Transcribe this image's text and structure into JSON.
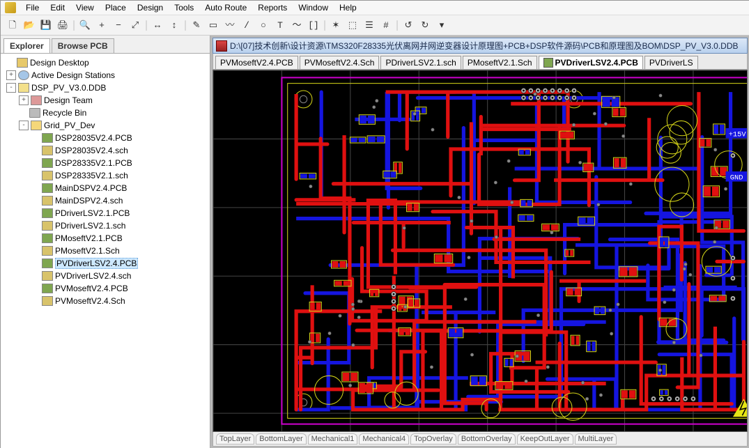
{
  "menu": {
    "items": [
      "File",
      "Edit",
      "View",
      "Place",
      "Design",
      "Tools",
      "Auto Route",
      "Reports",
      "Window",
      "Help"
    ]
  },
  "toolbar": {
    "buttons": [
      "🗋",
      "📂",
      "💾",
      "🖨",
      "|",
      "🔍",
      "+",
      "−",
      "⤢",
      "|",
      "↔",
      "↕",
      "|",
      "✎",
      "▭",
      "〰",
      "/",
      "○",
      "T",
      "〜",
      "[]",
      "|",
      "✶",
      "⬚",
      "☰",
      "#",
      "|",
      "↺",
      "↻",
      "▾"
    ]
  },
  "left_tabs": {
    "tabs": [
      {
        "label": "Explorer",
        "active": true
      },
      {
        "label": "Browse PCB",
        "active": false
      }
    ]
  },
  "tree": [
    {
      "depth": 0,
      "tw": "",
      "icon": "desk",
      "label": "Design Desktop"
    },
    {
      "depth": 0,
      "tw": "+",
      "icon": "net",
      "label": "Active Design Stations"
    },
    {
      "depth": 0,
      "tw": "-",
      "icon": "ddb",
      "label": "DSP_PV_V3.0.DDB"
    },
    {
      "depth": 1,
      "tw": "+",
      "icon": "team",
      "label": "Design Team"
    },
    {
      "depth": 1,
      "tw": "",
      "icon": "bin",
      "label": "Recycle Bin"
    },
    {
      "depth": 1,
      "tw": "-",
      "icon": "fld",
      "label": "Grid_PV_Dev"
    },
    {
      "depth": 2,
      "tw": "",
      "icon": "pcb",
      "label": "DSP28035V2.4.PCB"
    },
    {
      "depth": 2,
      "tw": "",
      "icon": "sch",
      "label": "DSP28035V2.4.sch"
    },
    {
      "depth": 2,
      "tw": "",
      "icon": "pcb",
      "label": "DSP28335V2.1.PCB"
    },
    {
      "depth": 2,
      "tw": "",
      "icon": "sch",
      "label": "DSP28335V2.1.sch"
    },
    {
      "depth": 2,
      "tw": "",
      "icon": "pcb",
      "label": "MainDSPV2.4.PCB"
    },
    {
      "depth": 2,
      "tw": "",
      "icon": "sch",
      "label": "MainDSPV2.4.sch"
    },
    {
      "depth": 2,
      "tw": "",
      "icon": "pcb",
      "label": "PDriverLSV2.1.PCB"
    },
    {
      "depth": 2,
      "tw": "",
      "icon": "sch",
      "label": "PDriverLSV2.1.sch"
    },
    {
      "depth": 2,
      "tw": "",
      "icon": "pcb",
      "label": "PMoseftV2.1.PCB"
    },
    {
      "depth": 2,
      "tw": "",
      "icon": "sch",
      "label": "PMoseftV2.1.Sch"
    },
    {
      "depth": 2,
      "tw": "",
      "icon": "pcb",
      "label": "PVDriverLSV2.4.PCB",
      "selected": true
    },
    {
      "depth": 2,
      "tw": "",
      "icon": "sch",
      "label": "PVDriverLSV2.4.sch"
    },
    {
      "depth": 2,
      "tw": "",
      "icon": "pcb",
      "label": "PVMoseftV2.4.PCB"
    },
    {
      "depth": 2,
      "tw": "",
      "icon": "sch",
      "label": "PVMoseftV2.4.Sch"
    }
  ],
  "doc_title": "D:\\[07]技术创新\\设计资源\\TMS320F28335光伏离网并网逆变器设计原理图+PCB+DSP软件源码\\PCB和原理图及BOM\\DSP_PV_V3.0.DDB",
  "doc_tabs": [
    {
      "label": "PVMoseftV2.4.PCB",
      "active": false,
      "icon": false
    },
    {
      "label": "PVMoseftV2.4.Sch",
      "active": false,
      "icon": false
    },
    {
      "label": "PDriverLSV2.1.sch",
      "active": false,
      "icon": false
    },
    {
      "label": "PMoseftV2.1.Sch",
      "active": false,
      "icon": false
    },
    {
      "label": "PVDriverLSV2.4.PCB",
      "active": true,
      "icon": true
    },
    {
      "label": "PVDriverLS",
      "active": false,
      "icon": false
    }
  ],
  "layer_tabs": [
    "TopLayer",
    "BottomLayer",
    "Mechanical1",
    "Mechanical4",
    "TopOverlay",
    "BottomOverlay",
    "KeepOutLayer",
    "MultiLayer"
  ],
  "pcb_text_labels": {
    "v15": "+15V",
    "gnd": "GND"
  }
}
